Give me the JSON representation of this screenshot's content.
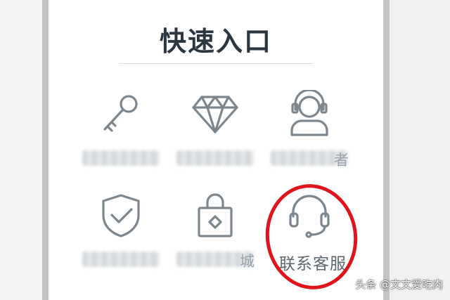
{
  "panel": {
    "title": "快速入口"
  },
  "tiles": [
    {
      "icon": "key-icon",
      "label": "",
      "tail": ""
    },
    {
      "icon": "diamond-icon",
      "label": "",
      "tail": ""
    },
    {
      "icon": "customer-service-avatar-icon",
      "label": "",
      "tail": "者"
    },
    {
      "icon": "shield-check-icon",
      "label": "",
      "tail": ""
    },
    {
      "icon": "shopping-bag-icon",
      "label": "",
      "tail": "城"
    },
    {
      "icon": "headset-icon",
      "label": "联系客服",
      "tail": ""
    }
  ],
  "watermark": "头条 @文文爱吃肉",
  "colors": {
    "icon_stroke": "#7d868c",
    "title": "#2b3640",
    "highlight_circle": "#e0141c",
    "panel_border": "#c4c4c4"
  }
}
